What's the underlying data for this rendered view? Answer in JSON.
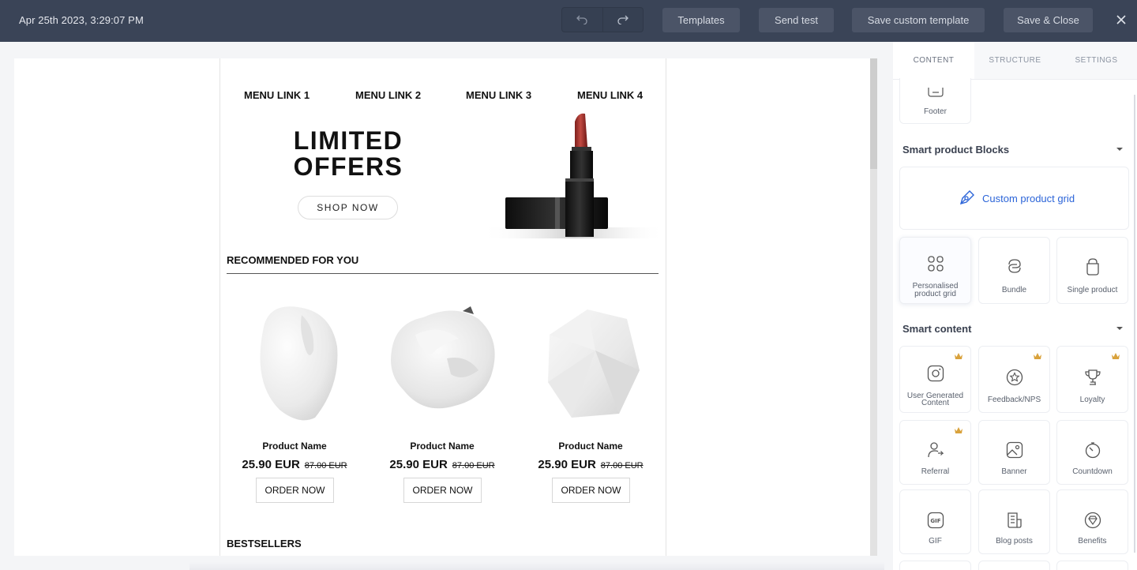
{
  "topbar": {
    "timestamp": "Apr 25th 2023, 3:29:07 PM",
    "templates_label": "Templates",
    "send_test_label": "Send test",
    "save_custom_label": "Save custom template",
    "save_close_label": "Save & Close"
  },
  "email": {
    "menu": [
      "MENU LINK 1",
      "MENU LINK 2",
      "MENU LINK 3",
      "MENU LINK 4"
    ],
    "hero": {
      "title_line1": "LIMITED",
      "title_line2": "OFFERS",
      "button": "SHOP NOW"
    },
    "recommended_title": "RECOMMENDED FOR YOU",
    "products": [
      {
        "name": "Product Name",
        "price": "25.90 EUR",
        "old_price": "87.00 EUR",
        "button": "ORDER NOW"
      },
      {
        "name": "Product Name",
        "price": "25.90 EUR",
        "old_price": "87.00 EUR",
        "button": "ORDER NOW"
      },
      {
        "name": "Product Name",
        "price": "25.90 EUR",
        "old_price": "87.00 EUR",
        "button": "ORDER NOW"
      }
    ],
    "bestsellers_title": "BESTSELLERS"
  },
  "panel": {
    "tabs": [
      "CONTENT",
      "STRUCTURE",
      "SETTINGS"
    ],
    "active_tab": "CONTENT",
    "footer_label": "Footer",
    "smart_product": {
      "title": "Smart product Blocks",
      "custom_grid": "Custom product grid",
      "items": [
        {
          "label_line1": "Personalised",
          "label_line2": "product grid",
          "icon": "grid-icon"
        },
        {
          "label_line1": "Bundle",
          "label_line2": "",
          "icon": "bundle-icon"
        },
        {
          "label_line1": "Single product",
          "label_line2": "",
          "icon": "bag-icon"
        }
      ]
    },
    "smart_content": {
      "title": "Smart content",
      "items": [
        {
          "label_line1": "User Generated",
          "label_line2": "Content",
          "icon": "instagram-icon",
          "premium": true
        },
        {
          "label_line1": "Feedback/NPS",
          "label_line2": "",
          "icon": "star-badge-icon",
          "premium": true
        },
        {
          "label_line1": "Loyalty",
          "label_line2": "",
          "icon": "trophy-icon",
          "premium": true
        },
        {
          "label_line1": "Referral",
          "label_line2": "",
          "icon": "referral-icon",
          "premium": true
        },
        {
          "label_line1": "Banner",
          "label_line2": "",
          "icon": "image-icon",
          "premium": false
        },
        {
          "label_line1": "Countdown",
          "label_line2": "",
          "icon": "timer-icon",
          "premium": false
        },
        {
          "label_line1": "GIF",
          "label_line2": "",
          "icon": "gif-icon",
          "premium": false
        },
        {
          "label_line1": "Blog posts",
          "label_line2": "",
          "icon": "blog-icon",
          "premium": false
        },
        {
          "label_line1": "Benefits",
          "label_line2": "",
          "icon": "benefits-icon",
          "premium": false
        }
      ]
    },
    "colors": {
      "accent": "#2b64d8",
      "premium": "#d9a23c",
      "topbar": "#3a4457"
    }
  }
}
